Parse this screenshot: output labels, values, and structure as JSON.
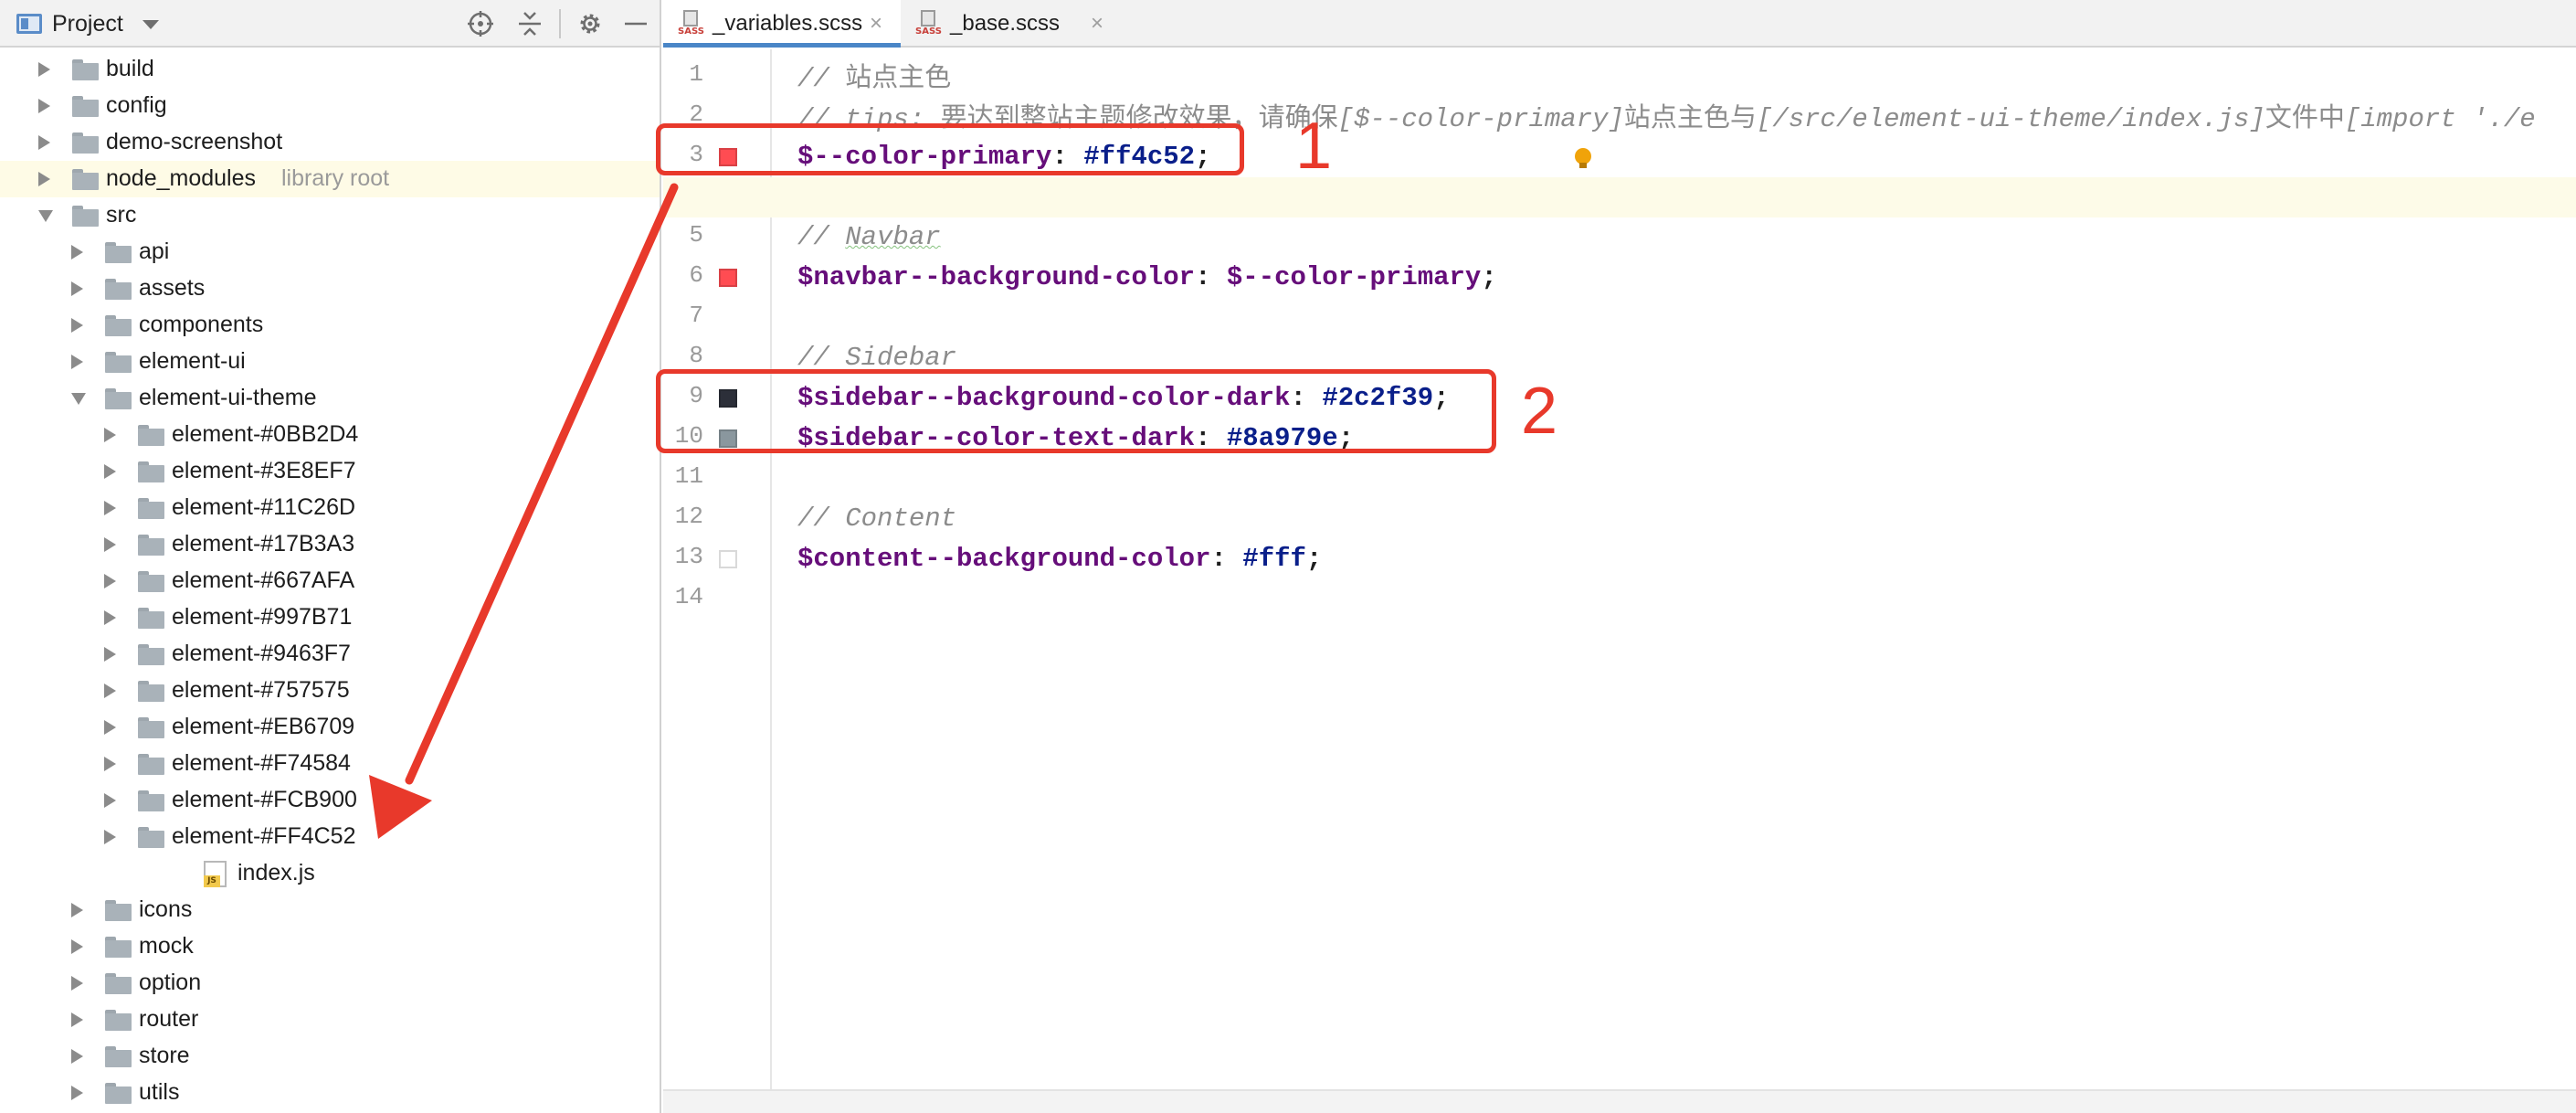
{
  "project_panel": {
    "title": "Project",
    "tree": [
      {
        "label": "build",
        "type": "folder",
        "depth": 0,
        "state": "collapsed"
      },
      {
        "label": "config",
        "type": "folder",
        "depth": 0,
        "state": "collapsed"
      },
      {
        "label": "demo-screenshot",
        "type": "folder",
        "depth": 0,
        "state": "collapsed"
      },
      {
        "label": "node_modules",
        "note": "library root",
        "type": "folder",
        "depth": 0,
        "state": "collapsed",
        "highlight": true
      },
      {
        "label": "src",
        "type": "folder",
        "depth": 0,
        "state": "expanded"
      },
      {
        "label": "api",
        "type": "folder",
        "depth": 1,
        "state": "collapsed"
      },
      {
        "label": "assets",
        "type": "folder",
        "depth": 1,
        "state": "collapsed"
      },
      {
        "label": "components",
        "type": "folder",
        "depth": 1,
        "state": "collapsed"
      },
      {
        "label": "element-ui",
        "type": "folder",
        "depth": 1,
        "state": "collapsed"
      },
      {
        "label": "element-ui-theme",
        "type": "folder",
        "depth": 1,
        "state": "expanded"
      },
      {
        "label": "element-#0BB2D4",
        "type": "folder",
        "depth": 2,
        "state": "collapsed"
      },
      {
        "label": "element-#3E8EF7",
        "type": "folder",
        "depth": 2,
        "state": "collapsed"
      },
      {
        "label": "element-#11C26D",
        "type": "folder",
        "depth": 2,
        "state": "collapsed"
      },
      {
        "label": "element-#17B3A3",
        "type": "folder",
        "depth": 2,
        "state": "collapsed"
      },
      {
        "label": "element-#667AFA",
        "type": "folder",
        "depth": 2,
        "state": "collapsed"
      },
      {
        "label": "element-#997B71",
        "type": "folder",
        "depth": 2,
        "state": "collapsed"
      },
      {
        "label": "element-#9463F7",
        "type": "folder",
        "depth": 2,
        "state": "collapsed"
      },
      {
        "label": "element-#757575",
        "type": "folder",
        "depth": 2,
        "state": "collapsed"
      },
      {
        "label": "element-#EB6709",
        "type": "folder",
        "depth": 2,
        "state": "collapsed"
      },
      {
        "label": "element-#F74584",
        "type": "folder",
        "depth": 2,
        "state": "collapsed"
      },
      {
        "label": "element-#FCB900",
        "type": "folder",
        "depth": 2,
        "state": "collapsed"
      },
      {
        "label": "element-#FF4C52",
        "type": "folder",
        "depth": 2,
        "state": "collapsed"
      },
      {
        "label": "index.js",
        "type": "js",
        "depth": 2,
        "state": "none"
      },
      {
        "label": "icons",
        "type": "folder",
        "depth": 1,
        "state": "collapsed"
      },
      {
        "label": "mock",
        "type": "folder",
        "depth": 1,
        "state": "collapsed"
      },
      {
        "label": "option",
        "type": "folder",
        "depth": 1,
        "state": "collapsed"
      },
      {
        "label": "router",
        "type": "folder",
        "depth": 1,
        "state": "collapsed"
      },
      {
        "label": "store",
        "type": "folder",
        "depth": 1,
        "state": "collapsed"
      },
      {
        "label": "utils",
        "type": "folder",
        "depth": 1,
        "state": "collapsed"
      }
    ]
  },
  "tabs": [
    {
      "label": "_variables.scss",
      "icon_text": "SASS",
      "active": true
    },
    {
      "label": "_base.scss",
      "icon_text": "SASS",
      "active": false
    }
  ],
  "editor": {
    "lines": [
      {
        "num": "1",
        "swatch": null,
        "parts": [
          [
            "comment",
            "// "
          ],
          [
            "cjk",
            "站点主色"
          ]
        ]
      },
      {
        "num": "2",
        "swatch": null,
        "parts": [
          [
            "comment",
            "/"
          ],
          [
            "comment",
            "/ tips: "
          ],
          [
            "cjk",
            "要达到整站主题修改效果，请确保"
          ],
          [
            "comment",
            "[$--color-primary]"
          ],
          [
            "cjk",
            "站点主色与"
          ],
          [
            "comment",
            "[/src/element-ui-theme/index.js]"
          ],
          [
            "cjk",
            "文件中"
          ],
          [
            "comment",
            "[import './e"
          ]
        ]
      },
      {
        "num": "3",
        "swatch": "#ff4c52",
        "parts": [
          [
            "var",
            "$--color-primary"
          ],
          [
            "punct",
            ": "
          ],
          [
            "val",
            "#ff4c52"
          ],
          [
            "punct",
            ";"
          ]
        ]
      },
      {
        "num": "4",
        "swatch": null,
        "parts": []
      },
      {
        "num": "5",
        "swatch": null,
        "parts": [
          [
            "comment",
            "// "
          ],
          [
            "squiggle",
            "Navbar"
          ]
        ]
      },
      {
        "num": "6",
        "swatch": "#ff4c52",
        "parts": [
          [
            "var",
            "$navbar--background-color"
          ],
          [
            "punct",
            ": "
          ],
          [
            "var",
            "$--color-primary"
          ],
          [
            "punct",
            ";"
          ]
        ]
      },
      {
        "num": "7",
        "swatch": null,
        "parts": []
      },
      {
        "num": "8",
        "swatch": null,
        "parts": [
          [
            "comment",
            "// Sidebar"
          ]
        ]
      },
      {
        "num": "9",
        "swatch": "#2c2f39",
        "parts": [
          [
            "var",
            "$sidebar--background-color-dark"
          ],
          [
            "punct",
            ": "
          ],
          [
            "val",
            "#2c2f39"
          ],
          [
            "punct",
            ";"
          ]
        ]
      },
      {
        "num": "10",
        "swatch": "#8a979e",
        "parts": [
          [
            "var",
            "$sidebar--color-text-dark"
          ],
          [
            "punct",
            ": "
          ],
          [
            "val",
            "#8a979e"
          ],
          [
            "punct",
            ";"
          ]
        ]
      },
      {
        "num": "11",
        "swatch": null,
        "parts": []
      },
      {
        "num": "12",
        "swatch": null,
        "parts": [
          [
            "comment",
            "// Content"
          ]
        ]
      },
      {
        "num": "13",
        "swatch": "#ffffff",
        "parts": [
          [
            "var",
            "$content--background-color"
          ],
          [
            "punct",
            ": "
          ],
          [
            "val",
            "#fff"
          ],
          [
            "punct",
            ";"
          ]
        ]
      },
      {
        "num": "14",
        "swatch": null,
        "parts": []
      }
    ]
  },
  "annotations": {
    "label_1": "1",
    "label_2": "2",
    "color": "#e8392b"
  },
  "colors": {
    "accent": "#4a86c7",
    "annotation": "#e8392b"
  }
}
